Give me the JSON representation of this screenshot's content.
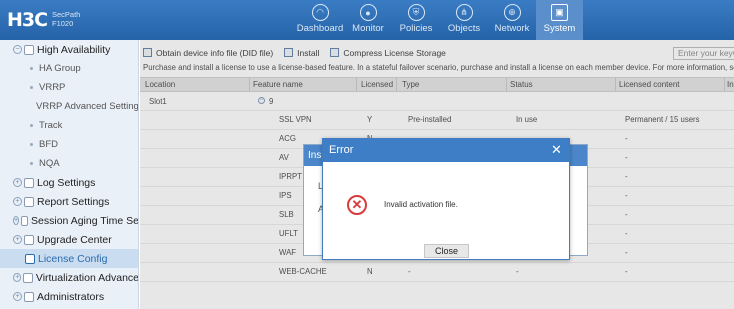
{
  "header": {
    "logo": "H3C",
    "product_line1": "SecPath",
    "product_line2": "F1020",
    "nav": [
      {
        "label": "Dashboard",
        "icon": "dashboard-icon",
        "glyph": "◠"
      },
      {
        "label": "Monitor",
        "icon": "monitor-icon",
        "glyph": "●"
      },
      {
        "label": "Policies",
        "icon": "policies-icon",
        "glyph": "⛨"
      },
      {
        "label": "Objects",
        "icon": "objects-icon",
        "glyph": "⋔"
      },
      {
        "label": "Network",
        "icon": "network-icon",
        "glyph": "⊕"
      },
      {
        "label": "System",
        "icon": "system-icon",
        "glyph": "▣"
      }
    ],
    "active_nav": "System"
  },
  "sidebar": {
    "items": [
      {
        "label": "High Availability",
        "level": 1,
        "expanded": true
      },
      {
        "label": "HA Group",
        "level": 2
      },
      {
        "label": "VRRP",
        "level": 2
      },
      {
        "label": "VRRP Advanced Settings",
        "level": 2
      },
      {
        "label": "Track",
        "level": 2
      },
      {
        "label": "BFD",
        "level": 2
      },
      {
        "label": "NQA",
        "level": 2
      },
      {
        "label": "Log Settings",
        "level": 1
      },
      {
        "label": "Report Settings",
        "level": 1
      },
      {
        "label": "Session Aging Time Se",
        "level": 1
      },
      {
        "label": "Upgrade Center",
        "level": 1
      },
      {
        "label": "License Config",
        "level": 1,
        "active": true
      },
      {
        "label": "Virtualization Advance",
        "level": 1
      },
      {
        "label": "Administrators",
        "level": 1
      }
    ]
  },
  "toolbar": {
    "obtain_label": "Obtain device info file (DID file)",
    "install_label": "Install",
    "compress_label": "Compress License Storage",
    "search_placeholder": "Enter your keyw"
  },
  "info_text": "Purchase and install a license to use a license-based feature. In a stateful failover scenario, purchase and install a license on each member device. For more information, see L",
  "table": {
    "columns": [
      "Location",
      "Feature name",
      "Licensed",
      "Type",
      "Status",
      "Licensed content",
      "In"
    ],
    "slot": {
      "location": "Slot1",
      "count": "9"
    },
    "rows": [
      {
        "feature": "SSL VPN",
        "licensed": "Y",
        "type": "Pre-installed",
        "status": "In use",
        "content": "Permanent / 15 users"
      },
      {
        "feature": "ACG",
        "licensed": "N",
        "type": "",
        "status": "",
        "content": "-"
      },
      {
        "feature": "AV",
        "licensed": "",
        "type": "",
        "status": "",
        "content": "-"
      },
      {
        "feature": "IPRPT",
        "licensed": "",
        "type": "",
        "status": "",
        "content": "-"
      },
      {
        "feature": "IPS",
        "licensed": "",
        "type": "",
        "status": "",
        "content": "-"
      },
      {
        "feature": "SLB",
        "licensed": "",
        "type": "",
        "status": "",
        "content": "-"
      },
      {
        "feature": "UFLT",
        "licensed": "",
        "type": "",
        "status": "",
        "content": "-"
      },
      {
        "feature": "WAF",
        "licensed": "",
        "type": "",
        "status": "",
        "content": "-"
      },
      {
        "feature": "WEB-CACHE",
        "licensed": "N",
        "type": "-",
        "status": "-",
        "content": "-"
      }
    ]
  },
  "back_dialog": {
    "title_fragment": "Ins",
    "text_fragment_1": "L",
    "text_fragment_2": "A"
  },
  "error_dialog": {
    "title": "Error",
    "message": "Invalid activation file.",
    "button_label": "Close",
    "close_glyph": "✕",
    "error_glyph": "✕"
  },
  "colors": {
    "header_blue": "#2563a8",
    "dialog_blue": "#3d7ec6",
    "error_red": "#d83b3b",
    "sidebar_bg": "#e9f0f8"
  }
}
